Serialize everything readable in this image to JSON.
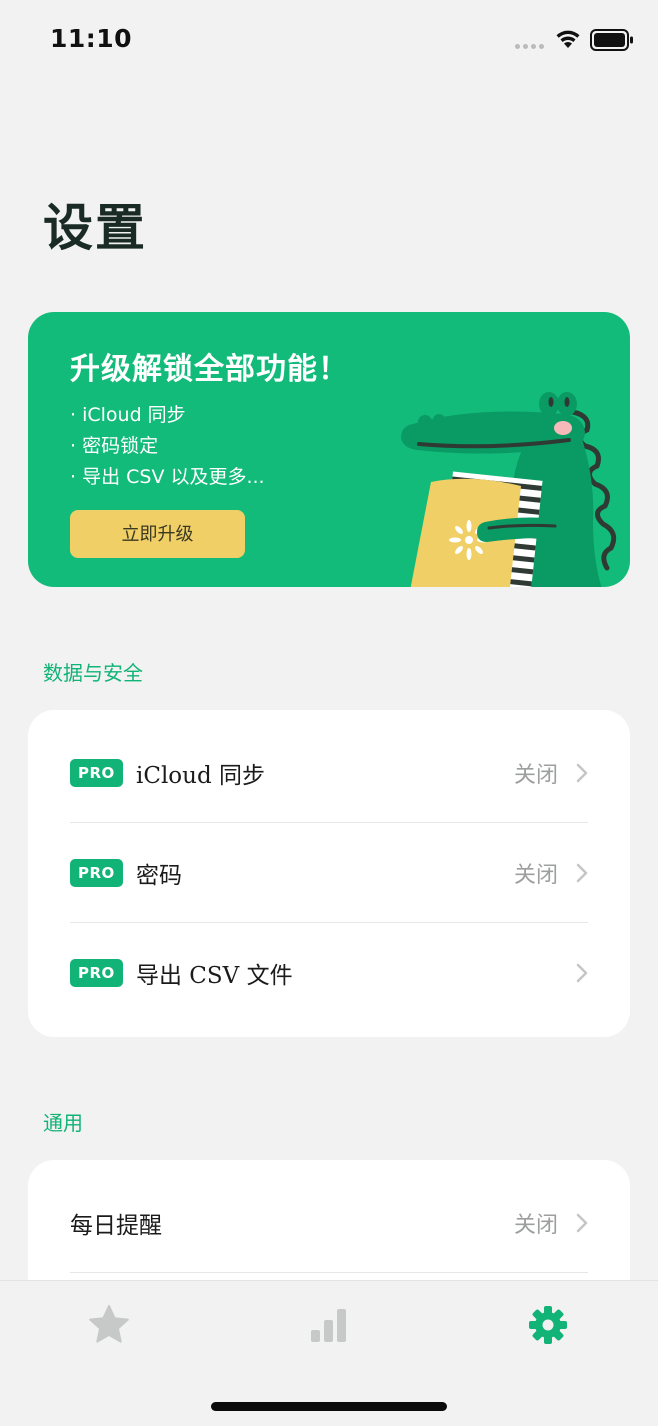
{
  "status_bar": {
    "time": "11:10"
  },
  "page_title": "设置",
  "promo": {
    "title": "升级解锁全部功能！",
    "features": [
      "· iCloud 同步",
      "· 密码锁定",
      "· 导出 CSV 以及更多..."
    ],
    "button_label": "立即升级",
    "colors": {
      "background": "#13bb7b",
      "button": "#f1cf67"
    }
  },
  "sections": {
    "data_security": {
      "header": "数据与安全",
      "rows": [
        {
          "badge": "PRO",
          "label": "iCloud 同步",
          "value": "关闭"
        },
        {
          "badge": "PRO",
          "label": "密码",
          "value": "关闭"
        },
        {
          "badge": "PRO",
          "label": "导出 CSV 文件",
          "value": ""
        }
      ]
    },
    "general": {
      "header": "通用",
      "rows": [
        {
          "label": "每日提醒",
          "value": "关闭"
        }
      ]
    }
  },
  "tab_bar": {
    "tabs": [
      {
        "icon": "star-icon",
        "active": false
      },
      {
        "icon": "bar-chart-icon",
        "active": false
      },
      {
        "icon": "gear-icon",
        "active": true
      }
    ],
    "colors": {
      "active": "#12b377",
      "inactive": "#c7c9c8"
    }
  },
  "colors": {
    "accent": "#12b377",
    "background": "#f1f2f1"
  }
}
